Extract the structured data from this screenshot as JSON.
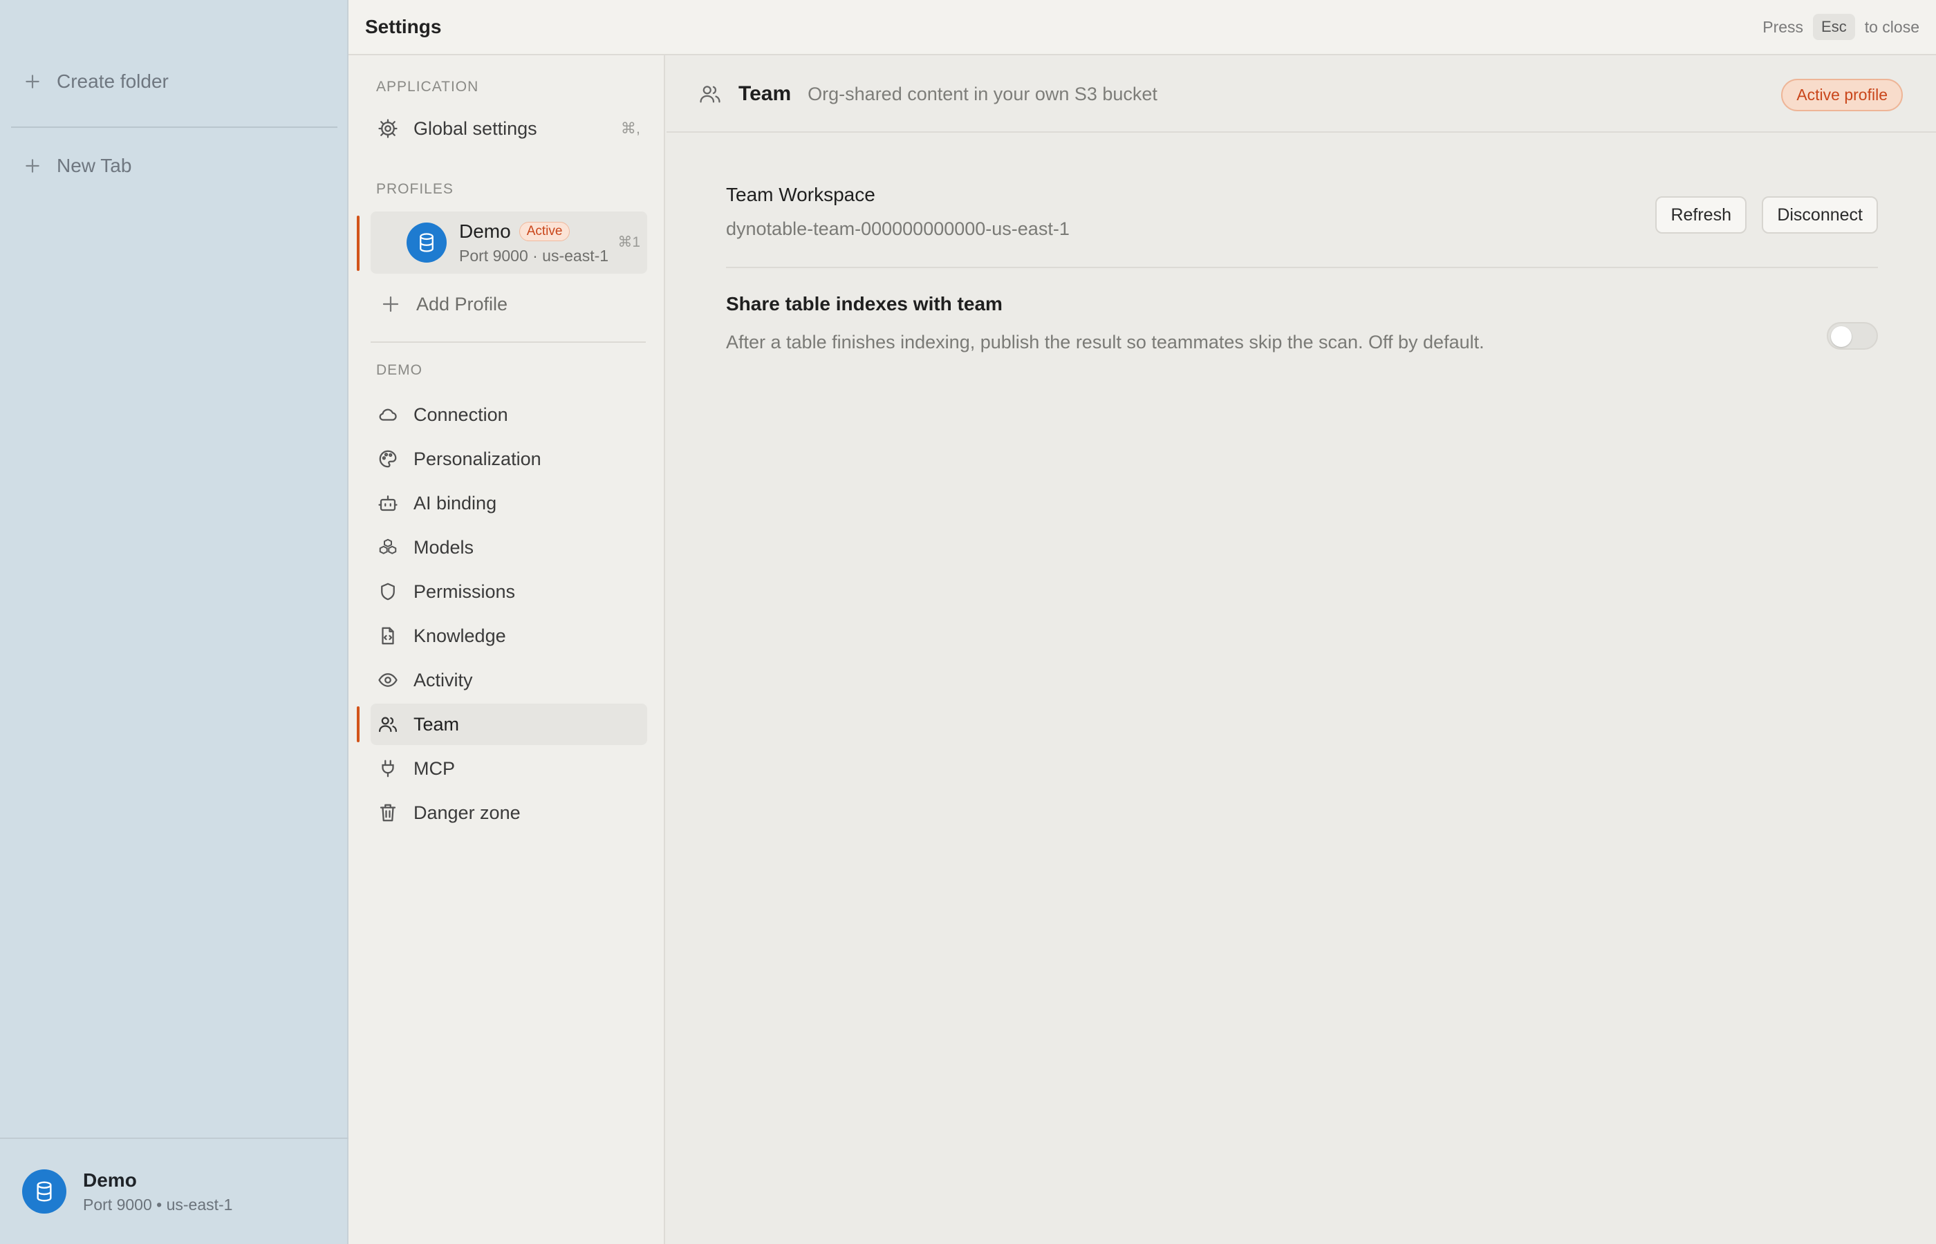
{
  "sidebar": {
    "create_folder": "Create folder",
    "new_tab": "New Tab",
    "footer": {
      "name": "Demo",
      "sub": "Port 9000 • us-east-1"
    }
  },
  "settings": {
    "title": "Settings",
    "esc_hint": {
      "press": "Press",
      "key": "Esc",
      "suffix": "to close"
    }
  },
  "nav": {
    "application_title": "APPLICATION",
    "global_settings": {
      "label": "Global settings",
      "shortcut": "⌘,"
    },
    "profiles_title": "PROFILES",
    "profile": {
      "name": "Demo",
      "badge": "Active",
      "sub": "Port 9000 · us-east-1",
      "shortcut": "⌘1"
    },
    "add_profile": "Add Profile",
    "demo_title": "DEMO",
    "items": [
      {
        "label": "Connection",
        "icon": "cloud-icon"
      },
      {
        "label": "Personalization",
        "icon": "palette-icon"
      },
      {
        "label": "AI binding",
        "icon": "bot-icon"
      },
      {
        "label": "Models",
        "icon": "boxes-icon"
      },
      {
        "label": "Permissions",
        "icon": "shield-icon"
      },
      {
        "label": "Knowledge",
        "icon": "file-code-icon"
      },
      {
        "label": "Activity",
        "icon": "eye-icon"
      },
      {
        "label": "Team",
        "icon": "users-icon"
      },
      {
        "label": "MCP",
        "icon": "plug-icon"
      },
      {
        "label": "Danger zone",
        "icon": "trash-icon"
      }
    ],
    "active_item": "Team"
  },
  "content": {
    "title": "Team",
    "subtitle": "Org-shared content in your own S3 bucket",
    "pill": "Active profile",
    "workspace": {
      "title": "Team Workspace",
      "id": "dynotable-team-000000000000-us-east-1",
      "refresh": "Refresh",
      "disconnect": "Disconnect"
    },
    "share": {
      "title": "Share table indexes with team",
      "desc": "After a table finishes indexing, publish the result so teammates skip the scan. Off by default.",
      "enabled": false
    }
  },
  "colors": {
    "accent": "#d2541a",
    "avatar": "#1e7bd0"
  }
}
